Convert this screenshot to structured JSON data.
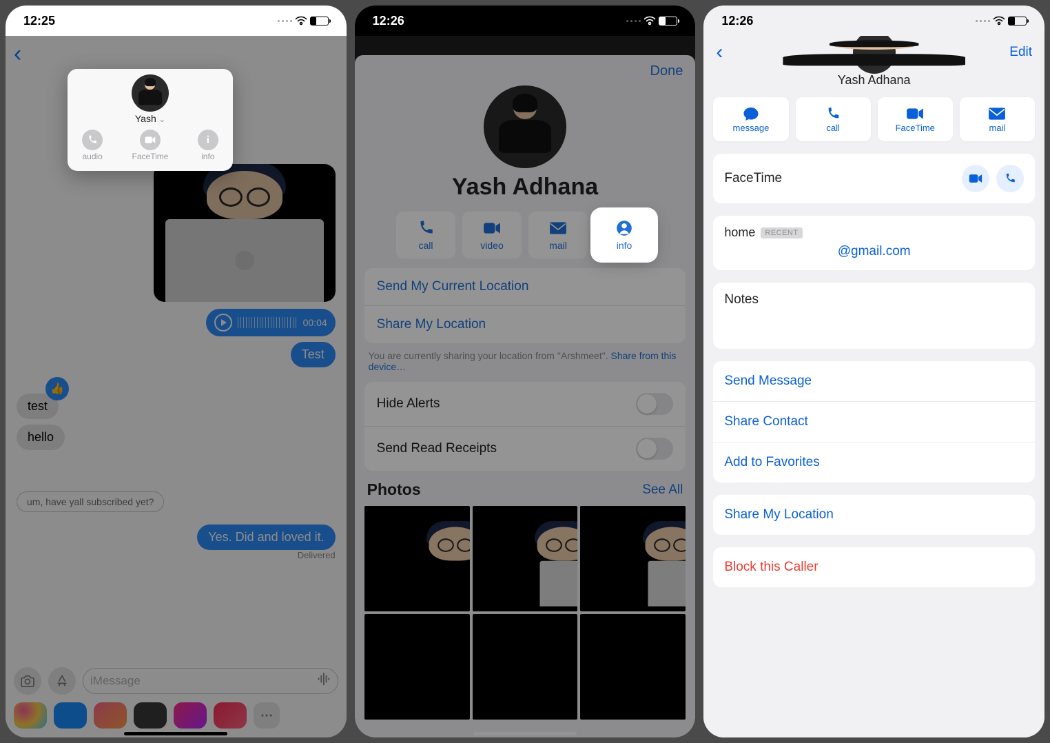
{
  "screen1": {
    "time": "12:25",
    "popup": {
      "name": "Yash",
      "actions": {
        "audio": "audio",
        "facetime": "FaceTime",
        "info": "info"
      }
    },
    "voice_duration": "00:04",
    "bubbles": {
      "test_out": "Test",
      "test_in": "test",
      "hello_in": "hello",
      "reply_out": "Yes. Did and loved it."
    },
    "suggestion": "um, have yall subscribed yet?",
    "delivered": "Delivered",
    "compose_placeholder": "iMessage"
  },
  "screen2": {
    "time": "12:26",
    "done": "Done",
    "name": "Yash Adhana",
    "actions": {
      "call": "call",
      "video": "video",
      "mail": "mail",
      "info": "info"
    },
    "send_location": "Send My Current Location",
    "share_location": "Share My Location",
    "sharing_note_pre": "You are currently sharing your location from \"Arshmeet\". ",
    "sharing_note_link": "Share from this device…",
    "hide_alerts": "Hide Alerts",
    "send_read": "Send Read Receipts",
    "photos": "Photos",
    "see_all": "See All"
  },
  "screen3": {
    "time": "12:26",
    "edit": "Edit",
    "name": "Yash Adhana",
    "actions": {
      "message": "message",
      "call": "call",
      "facetime": "FaceTime",
      "mail": "mail"
    },
    "facetime": "FaceTime",
    "email_label": "home",
    "email_chip": "RECENT",
    "email_value": "@gmail.com",
    "notes": "Notes",
    "send_message": "Send Message",
    "share_contact": "Share Contact",
    "add_favorites": "Add to Favorites",
    "share_location": "Share My Location",
    "block": "Block this Caller"
  }
}
